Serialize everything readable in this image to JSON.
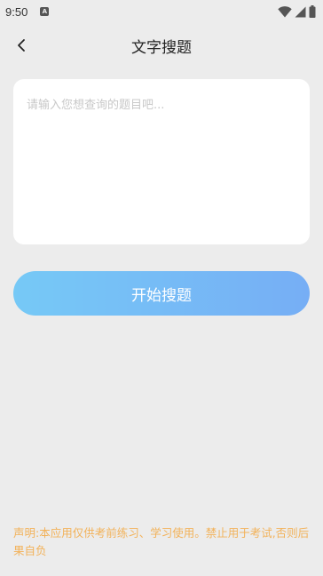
{
  "status_bar": {
    "time": "9:50",
    "app_icon_letter": "A",
    "icons": [
      "wifi-icon",
      "signal-icon",
      "battery-icon"
    ]
  },
  "header": {
    "back_icon": "chevron-left-icon",
    "title": "文字搜题"
  },
  "question": {
    "value": "",
    "placeholder": "请输入您想查询的题目吧..."
  },
  "search_button": {
    "label": "开始搜题"
  },
  "disclaimer": {
    "text": "声明:本应用仅供考前练习、学习使用。禁止用于考试,否则后果自负"
  },
  "colors": {
    "background": "#ececec",
    "button_gradient_start": "#76c9f6",
    "button_gradient_end": "#76aef5",
    "disclaimer": "#f2b25a",
    "placeholder": "#c8c8c8"
  }
}
